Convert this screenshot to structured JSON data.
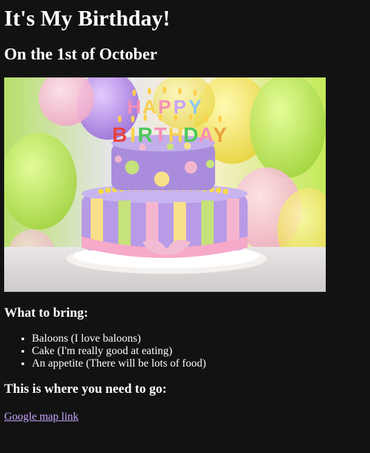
{
  "page": {
    "title": "It's My Birthday!",
    "subtitle": "On the 1st of October",
    "image": {
      "icon": "birthday-cake-image",
      "candle_text": "HAPPY BIRTHDAY"
    },
    "bring": {
      "heading": "What to bring:",
      "items": [
        "Baloons (I love baloons)",
        "Cake (I'm really good at eating)",
        "An appetite (There will be lots of food)"
      ]
    },
    "directions": {
      "heading": "This is where you need to go:",
      "link_text": "Google map link"
    }
  },
  "colors": {
    "background": "#121212",
    "text": "#ffffff",
    "link": "#c9a4ff"
  }
}
